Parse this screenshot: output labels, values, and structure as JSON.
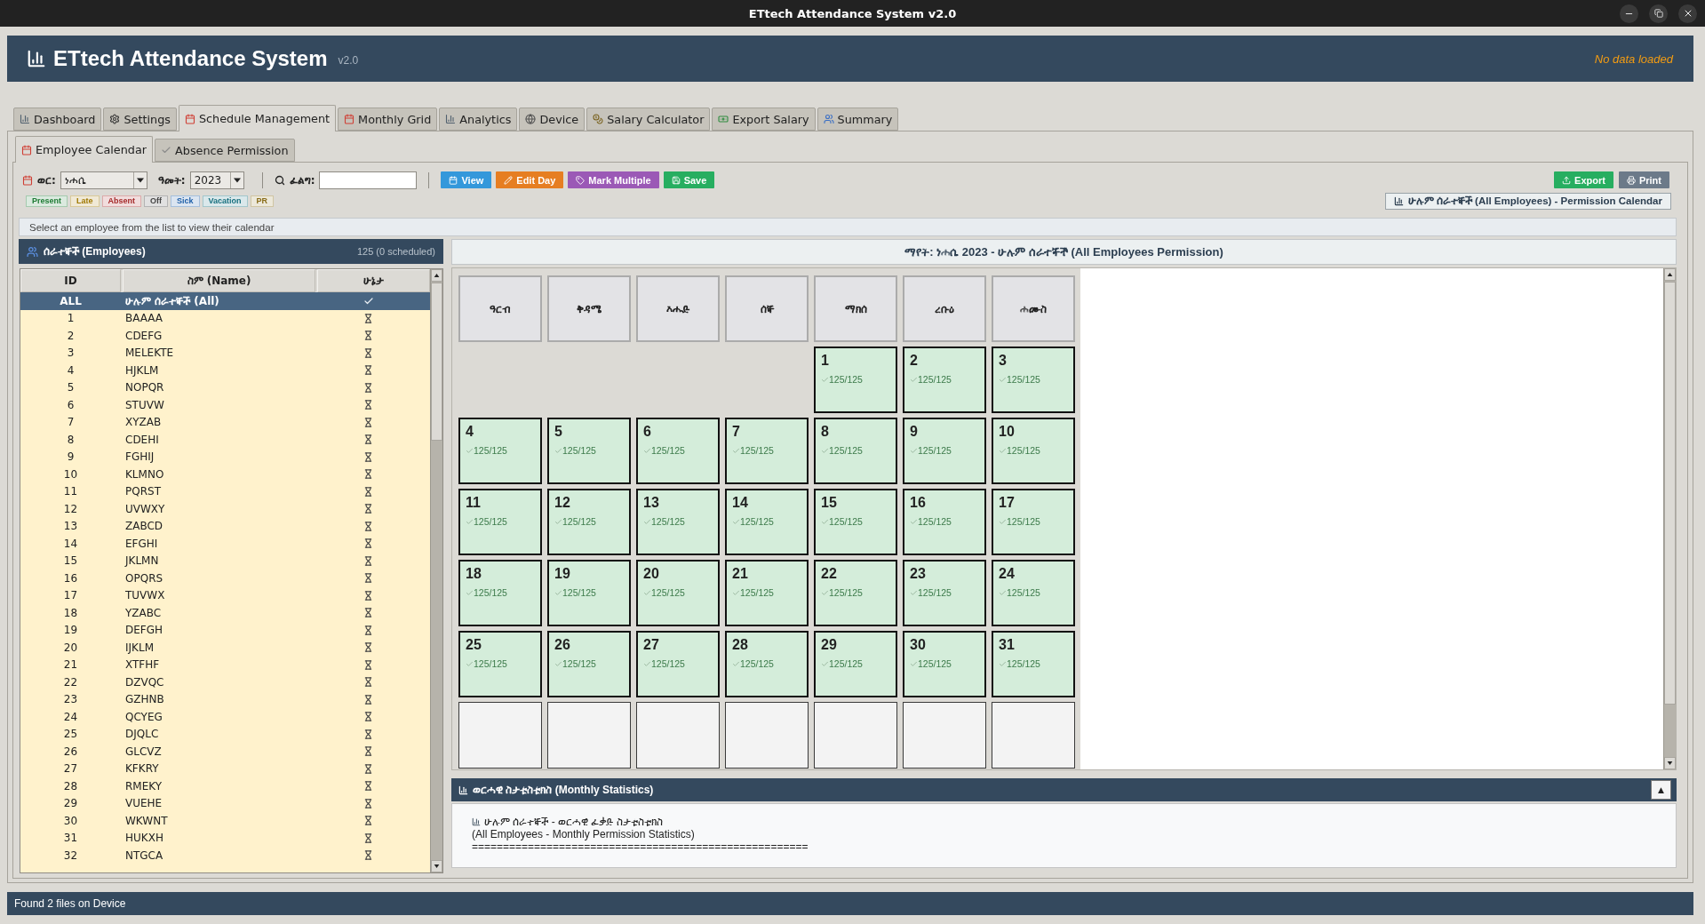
{
  "window": {
    "title": "ETtech Attendance System v2.0"
  },
  "header": {
    "title": "ETtech Attendance System",
    "version": "v2.0",
    "notice": "No data loaded"
  },
  "tabs": [
    {
      "label": "Dashboard",
      "kind": "chart",
      "selected": false
    },
    {
      "label": "Settings",
      "kind": "gear",
      "selected": false
    },
    {
      "label": "Schedule Management",
      "kind": "calendar",
      "selected": true
    },
    {
      "label": "Monthly Grid",
      "kind": "calendar",
      "selected": false
    },
    {
      "label": "Analytics",
      "kind": "chart",
      "selected": false
    },
    {
      "label": "Device",
      "kind": "globe",
      "selected": false
    },
    {
      "label": "Salary Calculator",
      "kind": "coins",
      "selected": false
    },
    {
      "label": "Export Salary",
      "kind": "money",
      "selected": false
    },
    {
      "label": "Summary",
      "kind": "people",
      "selected": false
    }
  ],
  "subtabs": [
    {
      "label": "Employee Calendar",
      "kind": "calendar",
      "selected": true
    },
    {
      "label": "Absence Permission",
      "kind": "check",
      "selected": false
    }
  ],
  "filters": {
    "month_label": "ወር:",
    "month": "ነሐሴ",
    "year_label": "ዓመት:",
    "year": "2023",
    "search_label": "ፈልግ:"
  },
  "actions": [
    {
      "label": "View",
      "kind": "calendar",
      "color": "#3498db"
    },
    {
      "label": "Edit Day",
      "kind": "pencil",
      "color": "#e67e22"
    },
    {
      "label": "Mark Multiple",
      "kind": "tag",
      "color": "#9b59b6"
    },
    {
      "label": "Save",
      "kind": "save",
      "color": "#27ae60"
    }
  ],
  "output_actions": [
    {
      "label": "Export",
      "kind": "upload",
      "color": "#27ae60"
    },
    {
      "label": "Print",
      "kind": "printer",
      "color": "#6c7a89"
    }
  ],
  "legend": [
    {
      "label": "Present",
      "color": "#1e7b34"
    },
    {
      "label": "Late",
      "color": "#a07800"
    },
    {
      "label": "Absent",
      "color": "#a52a2a"
    },
    {
      "label": "Off",
      "color": "#444444"
    },
    {
      "label": "Sick",
      "color": "#1f5fa8"
    },
    {
      "label": "Vacation",
      "color": "#17707f"
    },
    {
      "label": "PR",
      "color": "#8a6d1a"
    }
  ],
  "calendar_mode": {
    "label": "ሁሉም ሰራተኞች (All Employees) - Permission Calendar"
  },
  "hint": "Select an employee from the list to view their calendar",
  "employees": {
    "title": "ሰራተኞች (Employees)",
    "count": "125 (0 scheduled)",
    "columns": [
      "ID",
      "ስም (Name)",
      "ሁኔታ"
    ],
    "rows": [
      {
        "id": "ALL",
        "name": "ሁሉም ሰራተኞች (All)",
        "kind": "done",
        "selected": true
      },
      {
        "id": "1",
        "name": "BAAAA",
        "kind": "pending",
        "selected": false
      },
      {
        "id": "2",
        "name": "CDEFG",
        "kind": "pending",
        "selected": false
      },
      {
        "id": "3",
        "name": "MELEKTE",
        "kind": "pending",
        "selected": false
      },
      {
        "id": "4",
        "name": "HJKLM",
        "kind": "pending",
        "selected": false
      },
      {
        "id": "5",
        "name": "NOPQR",
        "kind": "pending",
        "selected": false
      },
      {
        "id": "6",
        "name": "STUVW",
        "kind": "pending",
        "selected": false
      },
      {
        "id": "7",
        "name": "XYZAB",
        "kind": "pending",
        "selected": false
      },
      {
        "id": "8",
        "name": "CDEHI",
        "kind": "pending",
        "selected": false
      },
      {
        "id": "9",
        "name": "FGHIJ",
        "kind": "pending",
        "selected": false
      },
      {
        "id": "10",
        "name": "KLMNO",
        "kind": "pending",
        "selected": false
      },
      {
        "id": "11",
        "name": "PQRST",
        "kind": "pending",
        "selected": false
      },
      {
        "id": "12",
        "name": "UVWXY",
        "kind": "pending",
        "selected": false
      },
      {
        "id": "13",
        "name": "ZABCD",
        "kind": "pending",
        "selected": false
      },
      {
        "id": "14",
        "name": "EFGHI",
        "kind": "pending",
        "selected": false
      },
      {
        "id": "15",
        "name": "JKLMN",
        "kind": "pending",
        "selected": false
      },
      {
        "id": "16",
        "name": "OPQRS",
        "kind": "pending",
        "selected": false
      },
      {
        "id": "17",
        "name": "TUVWX",
        "kind": "pending",
        "selected": false
      },
      {
        "id": "18",
        "name": "YZABC",
        "kind": "pending",
        "selected": false
      },
      {
        "id": "19",
        "name": "DEFGH",
        "kind": "pending",
        "selected": false
      },
      {
        "id": "20",
        "name": "IJKLM",
        "kind": "pending",
        "selected": false
      },
      {
        "id": "21",
        "name": "XTFHF",
        "kind": "pending",
        "selected": false
      },
      {
        "id": "22",
        "name": "DZVQC",
        "kind": "pending",
        "selected": false
      },
      {
        "id": "23",
        "name": "GZHNB",
        "kind": "pending",
        "selected": false
      },
      {
        "id": "24",
        "name": "QCYEG",
        "kind": "pending",
        "selected": false
      },
      {
        "id": "25",
        "name": "DJQLC",
        "kind": "pending",
        "selected": false
      },
      {
        "id": "26",
        "name": "GLCVZ",
        "kind": "pending",
        "selected": false
      },
      {
        "id": "27",
        "name": "KFKRY",
        "kind": "pending",
        "selected": false
      },
      {
        "id": "28",
        "name": "RMEKY",
        "kind": "pending",
        "selected": false
      },
      {
        "id": "29",
        "name": "VUEHE",
        "kind": "pending",
        "selected": false
      },
      {
        "id": "30",
        "name": "WKWNT",
        "kind": "pending",
        "selected": false
      },
      {
        "id": "31",
        "name": "HUKXH",
        "kind": "pending",
        "selected": false
      },
      {
        "id": "32",
        "name": "NTGCA",
        "kind": "pending",
        "selected": false
      }
    ]
  },
  "calendar": {
    "title": "ማየት: ነሐሴ 2023 - ሁሉም ሰራተኞች (All Employees Permission)",
    "weekdays": [
      "ዓርብ",
      "ቅዳሜ",
      "እሑድ",
      "ሰኞ",
      "ማክሰ",
      "ረቡዕ",
      "ሐሙስ"
    ],
    "cells": [
      {
        "kind": "gap"
      },
      {
        "kind": "gap"
      },
      {
        "kind": "gap"
      },
      {
        "kind": "gap"
      },
      {
        "kind": "day",
        "day": "1",
        "count": "125/125"
      },
      {
        "kind": "day",
        "day": "2",
        "count": "125/125"
      },
      {
        "kind": "day",
        "day": "3",
        "count": "125/125"
      },
      {
        "kind": "day",
        "day": "4",
        "count": "125/125"
      },
      {
        "kind": "day",
        "day": "5",
        "count": "125/125"
      },
      {
        "kind": "day",
        "day": "6",
        "count": "125/125"
      },
      {
        "kind": "day",
        "day": "7",
        "count": "125/125"
      },
      {
        "kind": "day",
        "day": "8",
        "count": "125/125"
      },
      {
        "kind": "day",
        "day": "9",
        "count": "125/125"
      },
      {
        "kind": "day",
        "day": "10",
        "count": "125/125"
      },
      {
        "kind": "day",
        "day": "11",
        "count": "125/125"
      },
      {
        "kind": "day",
        "day": "12",
        "count": "125/125"
      },
      {
        "kind": "day",
        "day": "13",
        "count": "125/125"
      },
      {
        "kind": "day",
        "day": "14",
        "count": "125/125"
      },
      {
        "kind": "day",
        "day": "15",
        "count": "125/125"
      },
      {
        "kind": "day",
        "day": "16",
        "count": "125/125"
      },
      {
        "kind": "day",
        "day": "17",
        "count": "125/125"
      },
      {
        "kind": "day",
        "day": "18",
        "count": "125/125"
      },
      {
        "kind": "day",
        "day": "19",
        "count": "125/125"
      },
      {
        "kind": "day",
        "day": "20",
        "count": "125/125"
      },
      {
        "kind": "day",
        "day": "21",
        "count": "125/125"
      },
      {
        "kind": "day",
        "day": "22",
        "count": "125/125"
      },
      {
        "kind": "day",
        "day": "23",
        "count": "125/125"
      },
      {
        "kind": "day",
        "day": "24",
        "count": "125/125"
      },
      {
        "kind": "day",
        "day": "25",
        "count": "125/125"
      },
      {
        "kind": "day",
        "day": "26",
        "count": "125/125"
      },
      {
        "kind": "day",
        "day": "27",
        "count": "125/125"
      },
      {
        "kind": "day",
        "day": "28",
        "count": "125/125"
      },
      {
        "kind": "day",
        "day": "29",
        "count": "125/125"
      },
      {
        "kind": "day",
        "day": "30",
        "count": "125/125"
      },
      {
        "kind": "day",
        "day": "31",
        "count": "125/125"
      },
      {
        "kind": "empty"
      },
      {
        "kind": "empty"
      },
      {
        "kind": "empty"
      },
      {
        "kind": "empty"
      },
      {
        "kind": "empty"
      },
      {
        "kind": "empty"
      },
      {
        "kind": "empty"
      }
    ]
  },
  "statistics": {
    "title": "ወርሓዊ ስታቲስቲክስ (Monthly Statistics)",
    "toggle": "▲",
    "heading": "ሁሉም ሰራተኞች - ወርሓዊ ፈቃድ ስታቲስቲክስ",
    "lines": [
      "(All Employees - Monthly Permission Statistics)",
      "======================================================"
    ]
  },
  "status_bar": "Found 2 files on Device"
}
